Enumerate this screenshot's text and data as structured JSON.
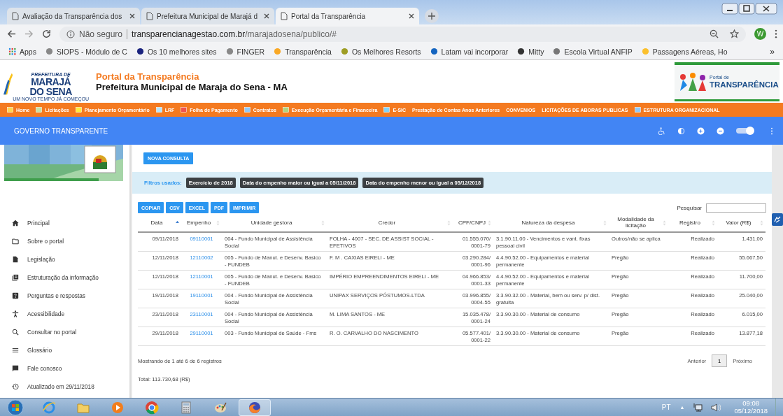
{
  "browser": {
    "tabs": [
      {
        "title": "Avaliação da Transparência dos",
        "selected": false
      },
      {
        "title": "Prefeitura Municipal de Marajá d",
        "selected": false
      },
      {
        "title": "Portal da Transparência",
        "selected": true
      }
    ],
    "address": {
      "security": "Não seguro",
      "url_host": "transparencianagestao.com.br",
      "url_path": "/marajadosena/publico/#",
      "avatar": "W"
    },
    "bookmarks": [
      "Apps",
      "SIOPS - Módulo de C",
      "Os 10 melhores sites",
      "FINGER",
      "Transparência",
      "Os Melhores Resorts",
      "Latam vai incorporar",
      "Mitty",
      "Escola Virtual ANFIP",
      "Passagens Aéreas, Ho"
    ],
    "bookmarks_more": "»"
  },
  "header": {
    "logo_lines": [
      "PREFEITURA DE",
      "MARAJÁ",
      "DO SENA",
      "UM NOVO TEMPO JÁ COMEÇOU"
    ],
    "title": "Portal da Transparência",
    "subtitle": "Prefeitura Municipal de Maraja do Sena - MA",
    "badge_lines": [
      "Portal de",
      "TRANSPARÊNCIA"
    ]
  },
  "nav": [
    {
      "label": "Home",
      "kind": "icon"
    },
    {
      "label": "Licitações",
      "kind": "icon"
    },
    {
      "label": "Planejamento Orçamentário",
      "kind": "icon"
    },
    {
      "label": "LRF",
      "kind": "icon"
    },
    {
      "label": "Folha de Pagamento",
      "kind": "icon"
    },
    {
      "label": "Contratos",
      "kind": "icon"
    },
    {
      "label": "Execução Orçamentária e Financeira",
      "kind": "icon"
    },
    {
      "label": "E-SIC",
      "kind": "icon"
    },
    {
      "label": "Prestação de Contas Anos Anteriores",
      "kind": "text"
    },
    {
      "label": "CONVENIOS",
      "kind": "text"
    },
    {
      "label": "LICITAÇÕES DE ABORAS PUBLICAS",
      "kind": "text"
    },
    {
      "label": "ESTRUTURA ORGANIZACIONAL",
      "kind": "icon"
    }
  ],
  "appbar": {
    "title": "GOVERNO TRANSPARENTE",
    "toggle_on": true
  },
  "sidebar": [
    "Principal",
    "Sobre o portal",
    "Legislação",
    "Estruturação da informação",
    "Perguntas e respostas",
    "Acessibilidade",
    "Consultar no portal",
    "Glossário",
    "Fale conosco",
    "Atualizado em 29/11/2018"
  ],
  "main": {
    "new_button": "NOVA CONSULTA",
    "filters_label": "Filtros usados:",
    "filters": [
      "Exercício de 2018",
      "Data do empenho maior ou igual a 05/11/2018",
      "Data do empenho menor ou igual a 05/12/2018"
    ],
    "export_buttons": [
      "COPIAR",
      "CSV",
      "EXCEL",
      "PDF",
      "IMPRIMIR"
    ],
    "search_label": "Pesquisar",
    "columns": [
      {
        "label": "Data",
        "sorted": true
      },
      {
        "label": "Empenho",
        "sorted": false
      },
      {
        "label": "Unidade gestora",
        "sorted": false
      },
      {
        "label": "Credor",
        "sorted": false
      },
      {
        "label": "CPF/CNPJ",
        "sorted": false
      },
      {
        "label": "Natureza da despesa",
        "sorted": false
      },
      {
        "label": "Modalidade da licitação",
        "sorted": false
      },
      {
        "label": "Registro",
        "sorted": false
      },
      {
        "label": "Valor (R$)",
        "sorted": false
      }
    ],
    "rows": [
      {
        "data": "09/11/2018",
        "empenho": "09110001",
        "unidade": "004 - Fundo Municipal de Assistência Social",
        "credor": "FOLHA - 4007 - SEC. DE ASSIST SOCIAL - EFETIVOS",
        "cpf": "01.555.070/0001-79",
        "natureza": "3.1.90.11.00 - Vencimentos e vant. fixas pessoal civil",
        "modalidade": "Outros/não se aplica",
        "registro": "Realizado",
        "valor": "1.431,00"
      },
      {
        "data": "12/11/2018",
        "empenho": "12110002",
        "unidade": "005 - Fundo de Manut. e Desenv. Basico - FUNDEB",
        "credor": "F. M . CAXIAS EIRELI - ME",
        "cpf": "03.290.284/0001-96",
        "natureza": "4.4.90.52.00 - Equipamentos e material permanente",
        "modalidade": "Pregão",
        "registro": "Realizado",
        "valor": "55.667,50"
      },
      {
        "data": "12/11/2018",
        "empenho": "12110001",
        "unidade": "005 - Fundo de Manut. e Desenv. Basico - FUNDEB",
        "credor": "IMPÉRIO EMPREENDIMENTOS EIRELI - ME",
        "cpf": "04.966.853/0001-33",
        "natureza": "4.4.90.52.00 - Equipamentos e material permanente",
        "modalidade": "Pregão",
        "registro": "Realizado",
        "valor": "11.700,00"
      },
      {
        "data": "19/11/2018",
        "empenho": "19110001",
        "unidade": "004 - Fundo Municipal de Assistência Social",
        "credor": "UNIPAX SERVIÇOS PÓSTUMOS-LTDA",
        "cpf": "03.996.855/0004-55",
        "natureza": "3.3.90.32.00 - Material, bem ou serv. p/ dist. gratuita",
        "modalidade": "Pregão",
        "registro": "Realizado",
        "valor": "25.040,00"
      },
      {
        "data": "23/11/2018",
        "empenho": "23110001",
        "unidade": "004 - Fundo Municipal de Assistência Social",
        "credor": "M. LIMA SANTOS - ME",
        "cpf": "15.035.478/0001-24",
        "natureza": "3.3.90.30.00 - Material de consumo",
        "modalidade": "Pregão",
        "registro": "Realizado",
        "valor": "6.015,00"
      },
      {
        "data": "29/11/2018",
        "empenho": "29110001",
        "unidade": "003 - Fundo Municipal de Saúde - Fms",
        "credor": "R. O. CARVALHO DO NASCIMENTO",
        "cpf": "05.577.401/0001-22",
        "natureza": "3.3.90.30.00 - Material de consumo",
        "modalidade": "Pregão",
        "registro": "Realizado",
        "valor": "13.877,18"
      }
    ],
    "info": "Mostrando de 1 até 6 de 6 registros",
    "prev": "Anterior",
    "page": "1",
    "next": "Próximo",
    "total": "Total: 113.730,68 (R$)"
  },
  "taskbar": {
    "lang": "PT",
    "tray_arrow": "▲",
    "time": "09:08",
    "date": "05/12/2018"
  }
}
